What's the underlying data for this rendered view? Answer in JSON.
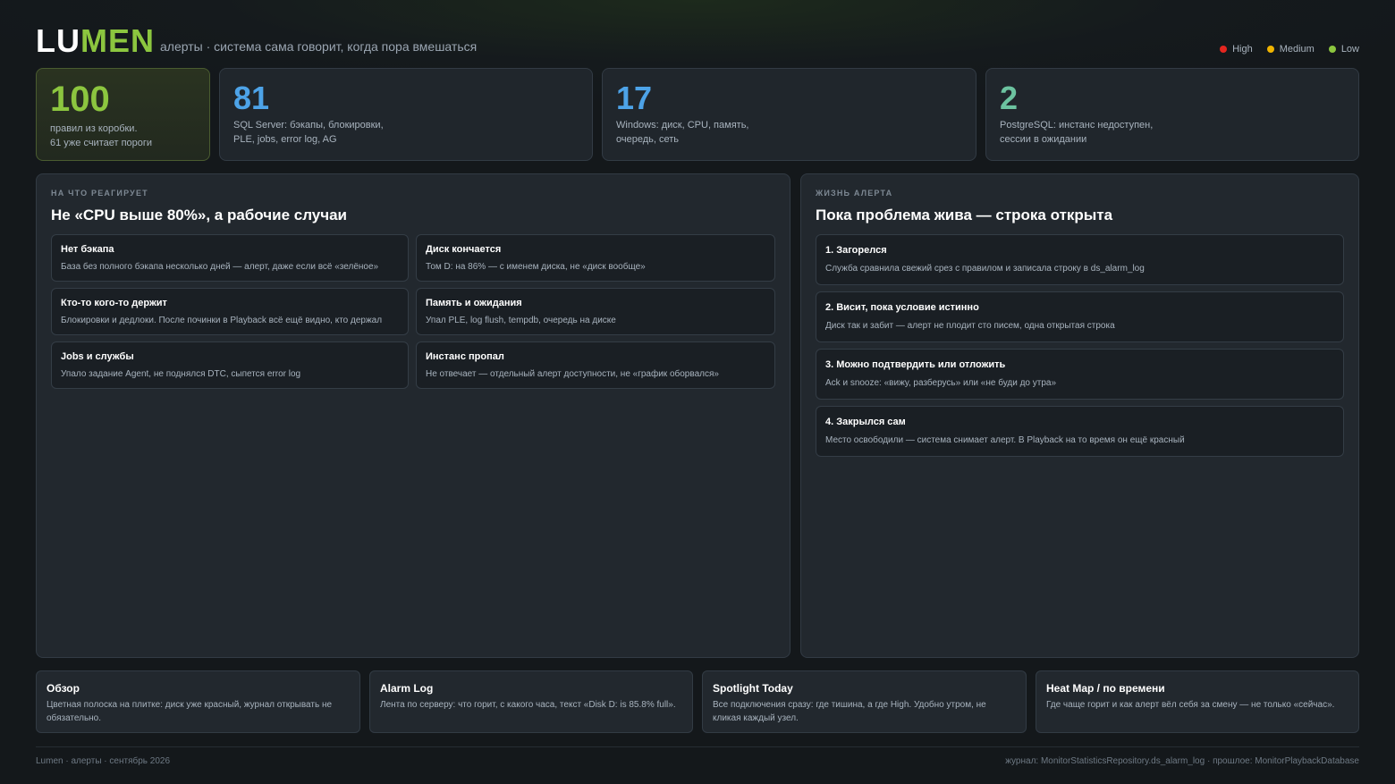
{
  "header": {
    "logo_part1": "LU",
    "logo_part2": "MEN",
    "tagline": "алерты · система сама говорит, когда пора вмешаться",
    "legend": [
      {
        "label": "High",
        "color": "#e5261f"
      },
      {
        "label": "Medium",
        "color": "#f0b400"
      },
      {
        "label": "Low",
        "color": "#8cc63f"
      }
    ]
  },
  "stats": [
    {
      "value": "100",
      "line1": "правил из коробки.",
      "line2": "61 уже считает пороги",
      "color": "#8cc63f"
    },
    {
      "value": "81",
      "line1": "SQL Server: бэкапы, блокировки,",
      "line2": "PLE, jobs, error log, AG",
      "color": "#4da3e8"
    },
    {
      "value": "17",
      "line1": "Windows: диск, CPU, память,",
      "line2": "очередь, сеть",
      "color": "#4da3e8"
    },
    {
      "value": "2",
      "line1": "PostgreSQL: инстанс недоступен,",
      "line2": "сессии в ожидании",
      "color": "#6cc3a0"
    }
  ],
  "left_panel": {
    "eyebrow": "НА ЧТО РЕАГИРУЕТ",
    "title": "Не «CPU выше 80%», а рабочие случаи",
    "cases": [
      {
        "title": "Нет бэкапа",
        "desc": "База без полного бэкапа несколько дней — алерт, даже если всё «зелёное»"
      },
      {
        "title": "Диск кончается",
        "desc": "Том D: на 86% — с именем диска, не «диск вообще»"
      },
      {
        "title": "Кто-то кого-то держит",
        "desc": "Блокировки и дедлоки. После починки в Playback всё ещё видно, кто держал"
      },
      {
        "title": "Память и ожидания",
        "desc": "Упал PLE, log flush, tempdb, очередь на диске"
      },
      {
        "title": "Jobs и службы",
        "desc": "Упало задание Agent, не поднялся DTC, сыпется error log"
      },
      {
        "title": "Инстанс пропал",
        "desc": "Не отвечает — отдельный алерт доступности, не «график оборвался»"
      }
    ]
  },
  "right_panel": {
    "eyebrow": "ЖИЗНЬ АЛЕРТА",
    "title": "Пока проблема жива — строка открыта",
    "steps": [
      {
        "title": "1. Загорелся",
        "desc": "Служба сравнила свежий срез с правилом и записала строку в ds_alarm_log"
      },
      {
        "title": "2. Висит, пока условие истинно",
        "desc": "Диск так и забит — алерт не плодит сто писем, одна открытая строка"
      },
      {
        "title": "3. Можно подтвердить или отложить",
        "desc": "Ack и snooze: «вижу, разберусь» или «не буди до утра»"
      },
      {
        "title": "4. Закрылся сам",
        "desc": "Место освободили — система снимает алерт. В Playback на то время он ещё красный"
      }
    ]
  },
  "cards": [
    {
      "title": "Обзор",
      "desc": "Цветная полоска на плитке: диск уже красный, журнал открывать не обязательно."
    },
    {
      "title": "Alarm Log",
      "desc": "Лента по серверу: что горит, с какого часа, текст «Disk D: is 85.8% full»."
    },
    {
      "title": "Spotlight Today",
      "desc": "Все подключения сразу: где тишина, а где High. Удобно утром, не кликая каждый узел."
    },
    {
      "title": "Heat Map / по времени",
      "desc": "Где чаще горит и как алерт вёл себя за смену — не только «сейчас»."
    }
  ],
  "footer": {
    "left": "Lumen · алерты · сентябрь 2026",
    "right": "журнал: MonitorStatisticsRepository.ds_alarm_log · прошлое: MonitorPlaybackDatabase"
  }
}
